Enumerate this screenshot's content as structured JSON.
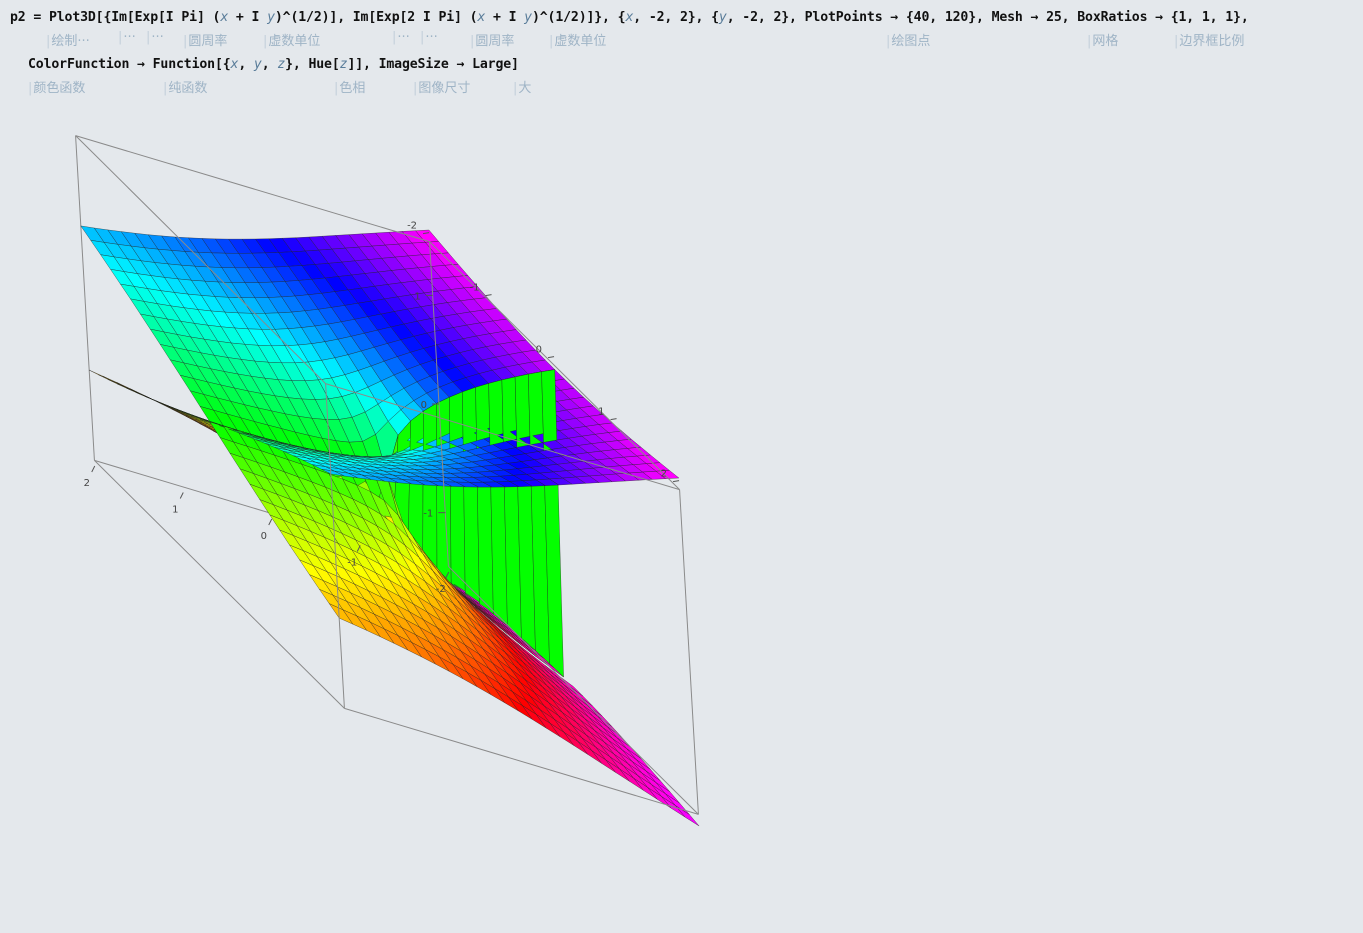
{
  "input": {
    "line1": [
      {
        "t": "p2 = Plot3D[{Im[Exp[I Pi] ("
      },
      {
        "t": "x",
        "v": true
      },
      {
        "t": " + I "
      },
      {
        "t": "y",
        "v": true
      },
      {
        "t": ")^(1/2)], Im[Exp[2 I Pi] ("
      },
      {
        "t": "x",
        "v": true
      },
      {
        "t": " + I "
      },
      {
        "t": "y",
        "v": true
      },
      {
        "t": ")^(1/2)]}, {"
      },
      {
        "t": "x",
        "v": true
      },
      {
        "t": ", -2, 2}, {"
      },
      {
        "t": "y",
        "v": true
      },
      {
        "t": ", -2, 2}, PlotPoints → {40, 120}, Mesh → 25, BoxRatios → {1, 1, 1},"
      }
    ],
    "line2": [
      {
        "t": "ColorFunction → Function[{"
      },
      {
        "t": "x",
        "v": true
      },
      {
        "t": ", "
      },
      {
        "t": "y",
        "v": true
      },
      {
        "t": ", "
      },
      {
        "t": "z",
        "v": true
      },
      {
        "t": "}, Hue["
      },
      {
        "t": "z",
        "v": true
      },
      {
        "t": "]], ImageSize → Large]"
      }
    ],
    "hints1": [
      "绘制···",
      "···",
      "···",
      "圆周率",
      "虚数单位",
      "···",
      "···",
      "圆周率",
      "虚数单位",
      "绘图点",
      "网格",
      "边界框比例"
    ],
    "hints2": [
      "颜色函数",
      "纯函数",
      "色相",
      "图像尺寸",
      "大"
    ]
  },
  "plot": {
    "ticks_y": [
      "-2",
      "-1",
      "0",
      "1",
      "2"
    ],
    "ticks_x": [
      "-2",
      "-1",
      "0",
      "1",
      "2"
    ],
    "ticks_z": [
      "-1",
      "0",
      "1"
    ],
    "colors": {
      "background": "#e4e8ec",
      "box": "#8a8a8a",
      "mesh": "#1e1e1e"
    }
  }
}
